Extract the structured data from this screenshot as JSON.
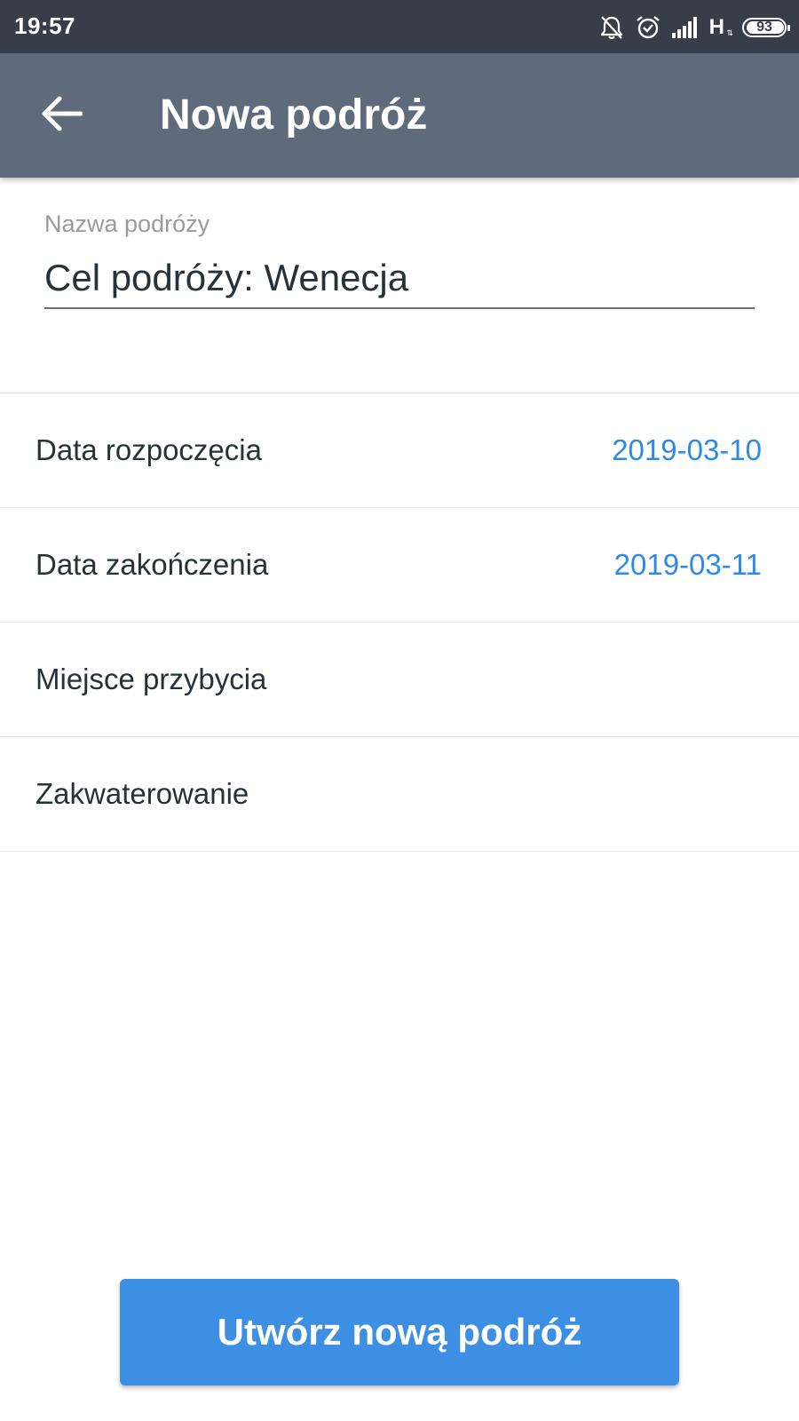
{
  "status_bar": {
    "time": "19:57",
    "network_type": "H",
    "battery_level": "93",
    "icons": [
      "notifications-off-icon",
      "alarm-icon",
      "signal-icon",
      "battery-icon"
    ]
  },
  "app_bar": {
    "back_icon": "arrow-back-icon",
    "title": "Nowa podróż"
  },
  "form": {
    "trip_name_label": "Nazwa podróży",
    "trip_name_value": "Cel podróży: Wenecja"
  },
  "rows": [
    {
      "label": "Data rozpoczęcia",
      "value": "2019-03-10"
    },
    {
      "label": "Data zakończenia",
      "value": "2019-03-11"
    },
    {
      "label": "Miejsce przybycia",
      "value": ""
    },
    {
      "label": "Zakwaterowanie",
      "value": ""
    }
  ],
  "create_button": {
    "label": "Utwórz nową podróż"
  },
  "colors": {
    "status_bar": "#373e4a",
    "app_bar": "#5f6a7b",
    "accent": "#2e8ae6",
    "button": "#3c8fe2"
  }
}
